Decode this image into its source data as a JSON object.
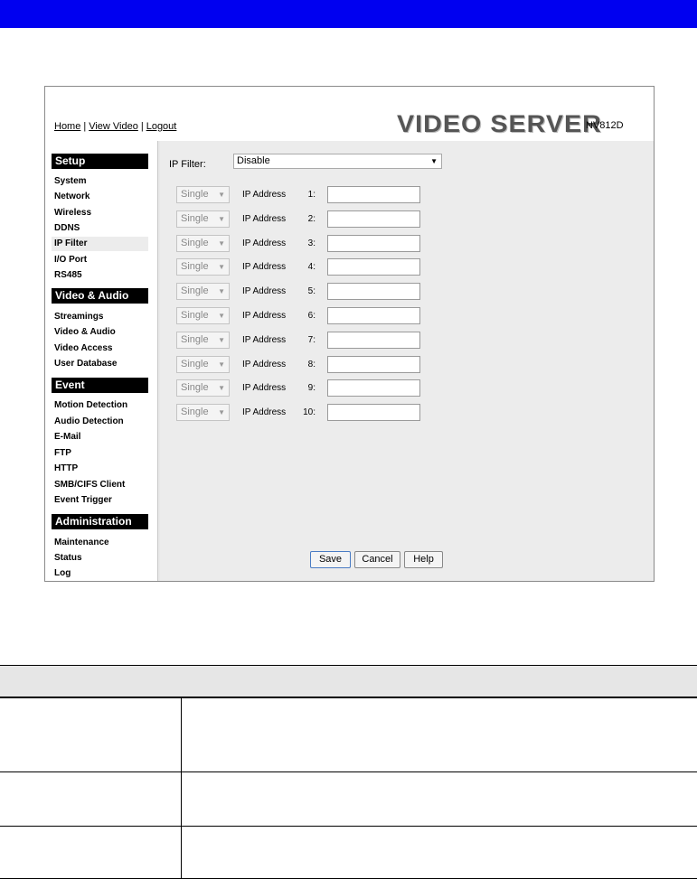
{
  "header": {
    "links": [
      "Home",
      "View Video",
      "Logout"
    ],
    "brand": "VIDEO SERVER",
    "model": "NV812D"
  },
  "sidebar": {
    "sections": [
      {
        "title": "Setup",
        "items": [
          "System",
          "Network",
          "Wireless",
          "DDNS",
          "IP Filter",
          "I/O Port",
          "RS485"
        ]
      },
      {
        "title": "Video & Audio",
        "items": [
          "Streamings",
          "Video & Audio",
          "Video Access",
          "User Database"
        ]
      },
      {
        "title": "Event",
        "items": [
          "Motion Detection",
          "Audio Detection",
          "E-Mail",
          "FTP",
          "HTTP",
          "SMB/CIFS Client",
          "Event Trigger"
        ]
      },
      {
        "title": "Administration",
        "items": [
          "Maintenance",
          "Status",
          "Log"
        ]
      }
    ],
    "active_item": "IP Filter"
  },
  "main": {
    "ip_filter_label": "IP Filter:",
    "ip_filter_value": "Disable",
    "address_label": "IP Address",
    "mode_value": "Single",
    "rows": [
      "1:",
      "2:",
      "3:",
      "4:",
      "5:",
      "6:",
      "7:",
      "8:",
      "9:",
      "10:"
    ],
    "buttons": {
      "save": "Save",
      "cancel": "Cancel",
      "help": "Help"
    }
  },
  "colors": {
    "top_bar": "#0000f0",
    "content_bg": "#ececec",
    "section_header": "#000000"
  }
}
